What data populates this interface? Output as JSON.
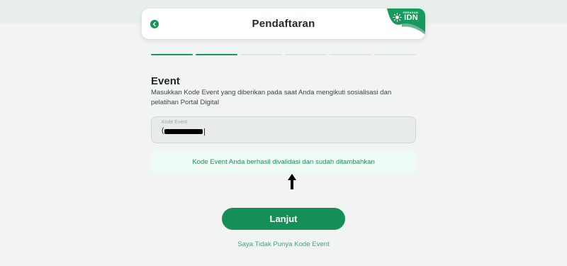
{
  "header": {
    "title": "Pendaftaran",
    "back_icon": "chevron-left-icon",
    "logo": {
      "sub": "GERAKAN",
      "text": "IDN",
      "icon": "sun-icon"
    }
  },
  "progress": {
    "total_steps": 6,
    "completed_steps": 2
  },
  "event_section": {
    "title": "Event",
    "description": "Masukkan Kode Event yang diberikan pada saat Anda mengikuti sosialisasi dan pelatihan Portal Digital",
    "input": {
      "label": "Kode Event",
      "value_visible_prefix": "("
    },
    "success_message": "Kode Event Anda berhasil divalidasi dan sudah ditambahkan"
  },
  "actions": {
    "primary_label": "Lanjut",
    "secondary_link": "Saya Tidak Punya Kode Event"
  },
  "colors": {
    "brand_green": "#158f57",
    "success_bg": "#effbf5",
    "success_text": "#2d8a5c",
    "page_bg": "#f2f4f3"
  }
}
